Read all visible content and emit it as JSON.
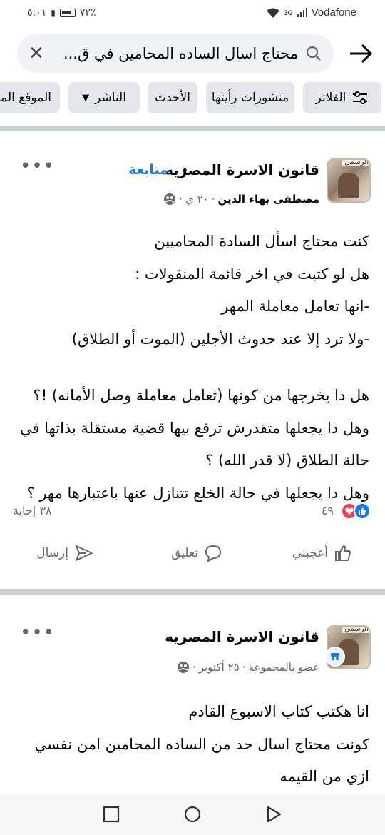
{
  "status_bar": {
    "time": "٥:٠١",
    "battery": "٧٢٪",
    "carrier": "Vodafone",
    "network": "3G"
  },
  "search": {
    "query": "محتاج اسال الساده المحامين في ق...",
    "icon": "search-icon",
    "clear_icon": "close-icon",
    "back_icon": "arrow-right-icon"
  },
  "filters": {
    "items": [
      {
        "label": "الفلاتر",
        "icon": "sliders-icon"
      },
      {
        "label": "منشورات رأيتها"
      },
      {
        "label": "الأحدث"
      },
      {
        "label": "الناشر",
        "icon": "caret-down-icon"
      },
      {
        "label": "الموقع المش"
      }
    ]
  },
  "post1": {
    "group_name": "قانون الاسرة المصريه",
    "follow_label": "متابعة",
    "author": "مصطفى بهاء الدين",
    "time": "٢٠ ي",
    "privacy_icon": "group-icon",
    "more_icon": "more-dots-icon",
    "avatar_label": "الرسمي",
    "lines": [
      "كنت محتاج اسأل السادة المحاميين",
      "هل لو كتبت في اخر قائمة المنقولات :",
      "-انها تعامل معاملة المهر",
      "-ولا ترد إلا عند حدوث الأجلين (الموت أو الطلاق)",
      "",
      "هل دا يخرجها من كونها (تعامل معاملة وصل الأمانه) !؟",
      "وهل دا يجعلها متقدرش ترفع بيها قضية مستقلة بذاتها في",
      "حالة الطلاق (لا قدر الله) ؟",
      "وهل دا يجعلها في حالة الخلع تتنازل عنها باعتبارها مهر ؟"
    ],
    "reaction_count": "٤٩",
    "answers": "٣٨ إجابة",
    "actions": {
      "like": "أعجبني",
      "comment": "تعليق",
      "send": "إرسال"
    }
  },
  "post2": {
    "group_name": "قانون الاسرة المصريه",
    "role": "عضو بالمجموعة",
    "time": "٢٥ أكتوبر",
    "avatar_label": "الرسمي",
    "lines": [
      "انا هكتب كتاب الاسبوع القادم",
      "كونت محتاج اسال حد من الساده المحامين امن نفسي",
      "ازي من القيمه"
    ]
  },
  "nav": {
    "recents_icon": "square-icon",
    "home_icon": "circle-icon",
    "back_icon": "triangle-back-icon"
  }
}
